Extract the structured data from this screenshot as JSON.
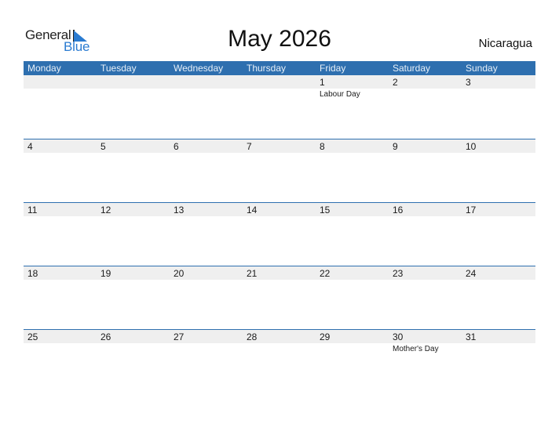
{
  "logo": {
    "word1": "General",
    "word2": "Blue",
    "icon": "triangle-flag-icon"
  },
  "title": "May 2026",
  "country": "Nicaragua",
  "colors": {
    "header_bar": "#2e6faf",
    "logo_blue": "#2a7bd1",
    "date_strip": "#efefef"
  },
  "weekdays": [
    "Monday",
    "Tuesday",
    "Wednesday",
    "Thursday",
    "Friday",
    "Saturday",
    "Sunday"
  ],
  "weeks": [
    [
      {
        "day": "",
        "holiday": ""
      },
      {
        "day": "",
        "holiday": ""
      },
      {
        "day": "",
        "holiday": ""
      },
      {
        "day": "",
        "holiday": ""
      },
      {
        "day": "1",
        "holiday": "Labour Day"
      },
      {
        "day": "2",
        "holiday": ""
      },
      {
        "day": "3",
        "holiday": ""
      }
    ],
    [
      {
        "day": "4",
        "holiday": ""
      },
      {
        "day": "5",
        "holiday": ""
      },
      {
        "day": "6",
        "holiday": ""
      },
      {
        "day": "7",
        "holiday": ""
      },
      {
        "day": "8",
        "holiday": ""
      },
      {
        "day": "9",
        "holiday": ""
      },
      {
        "day": "10",
        "holiday": ""
      }
    ],
    [
      {
        "day": "11",
        "holiday": ""
      },
      {
        "day": "12",
        "holiday": ""
      },
      {
        "day": "13",
        "holiday": ""
      },
      {
        "day": "14",
        "holiday": ""
      },
      {
        "day": "15",
        "holiday": ""
      },
      {
        "day": "16",
        "holiday": ""
      },
      {
        "day": "17",
        "holiday": ""
      }
    ],
    [
      {
        "day": "18",
        "holiday": ""
      },
      {
        "day": "19",
        "holiday": ""
      },
      {
        "day": "20",
        "holiday": ""
      },
      {
        "day": "21",
        "holiday": ""
      },
      {
        "day": "22",
        "holiday": ""
      },
      {
        "day": "23",
        "holiday": ""
      },
      {
        "day": "24",
        "holiday": ""
      }
    ],
    [
      {
        "day": "25",
        "holiday": ""
      },
      {
        "day": "26",
        "holiday": ""
      },
      {
        "day": "27",
        "holiday": ""
      },
      {
        "day": "28",
        "holiday": ""
      },
      {
        "day": "29",
        "holiday": ""
      },
      {
        "day": "30",
        "holiday": "Mother's Day"
      },
      {
        "day": "31",
        "holiday": ""
      }
    ]
  ]
}
